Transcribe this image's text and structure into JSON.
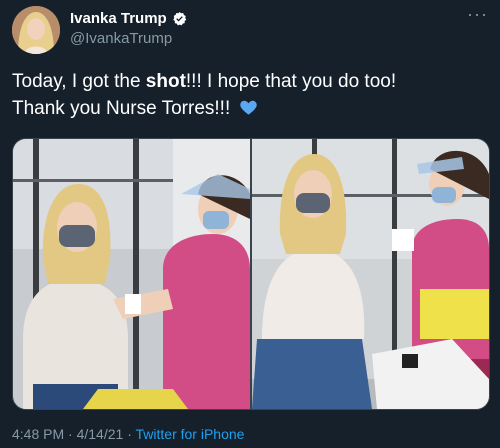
{
  "author": {
    "name": "Ivanka Trump",
    "handle": "@IvankaTrump"
  },
  "tweet": {
    "line1_before": "Today, I got the ",
    "line1_bold": "shot",
    "line1_after": "!!! I hope that you do too!",
    "line2": "Thank you Nurse Torres!!! "
  },
  "icons": {
    "verified": "verified-badge-icon",
    "more": "more-options-icon",
    "heart": "blue-heart-emoji-icon"
  },
  "media": {
    "count": 2
  },
  "meta": {
    "time": "4:48 PM",
    "separator1": " · ",
    "date": "4/14/21",
    "separator2": " · ",
    "source": "Twitter for iPhone"
  },
  "colors": {
    "background": "#15202b",
    "secondary_text": "#8899a6",
    "link": "#1da1f2",
    "verified": "#1da1f2"
  }
}
